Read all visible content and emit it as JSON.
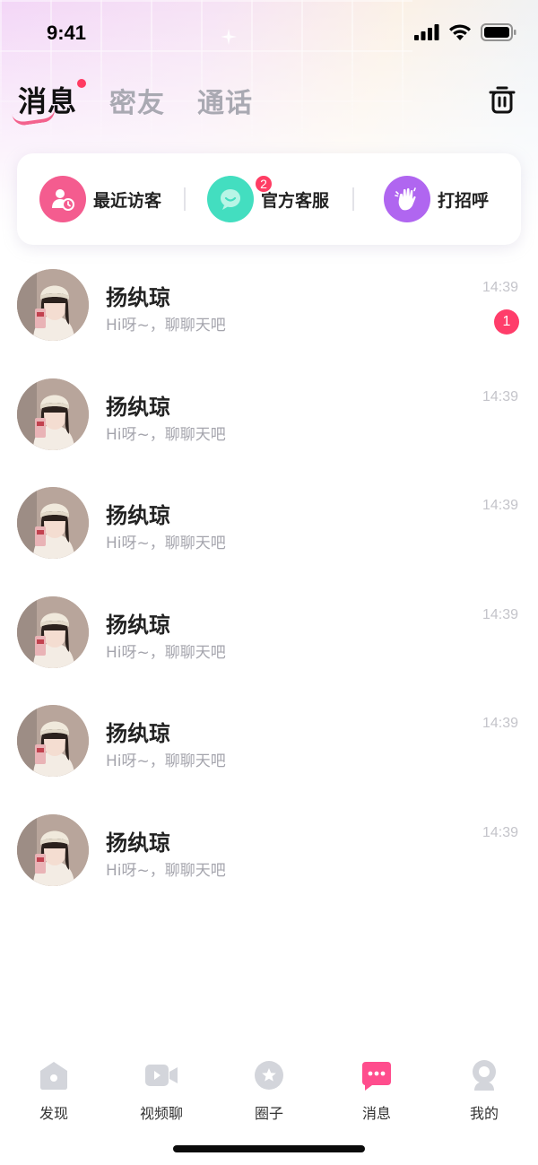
{
  "status_bar": {
    "time": "9:41"
  },
  "tabs": [
    {
      "label": "消息",
      "active": true,
      "dot": true
    },
    {
      "label": "密友",
      "active": false
    },
    {
      "label": "通话",
      "active": false
    }
  ],
  "header": {
    "trash_icon": "trash-icon"
  },
  "quick_actions": [
    {
      "label": "最近访客",
      "icon": "visitor-icon",
      "color": "#f45c8f"
    },
    {
      "label": "官方客服",
      "icon": "service-chat-icon",
      "color": "#43dec0",
      "badge": "2"
    },
    {
      "label": "打招呼",
      "icon": "wave-hand-icon",
      "color": "#b066f0"
    }
  ],
  "messages": [
    {
      "name": "扬纨琼",
      "preview": "Hi呀~，聊聊天吧",
      "time": "14:39",
      "unread": "1"
    },
    {
      "name": "扬纨琼",
      "preview": "Hi呀~，聊聊天吧",
      "time": "14:39"
    },
    {
      "name": "扬纨琼",
      "preview": "Hi呀~，聊聊天吧",
      "time": "14:39"
    },
    {
      "name": "扬纨琼",
      "preview": "Hi呀~，聊聊天吧",
      "time": "14:39"
    },
    {
      "name": "扬纨琼",
      "preview": "Hi呀~，聊聊天吧",
      "time": "14:39"
    },
    {
      "name": "扬纨琼",
      "preview": "Hi呀~，聊聊天吧",
      "time": "14:39"
    }
  ],
  "bottom_nav": [
    {
      "label": "发现",
      "icon": "home-icon",
      "active": false
    },
    {
      "label": "视频聊",
      "icon": "video-icon",
      "active": false
    },
    {
      "label": "圈子",
      "icon": "star-circle-icon",
      "active": false
    },
    {
      "label": "消息",
      "icon": "message-icon",
      "active": true
    },
    {
      "label": "我的",
      "icon": "profile-icon",
      "active": false
    }
  ],
  "colors": {
    "accent": "#ff4d8d",
    "badge": "#ff3d64",
    "inactive_tab": "#a9a9b2"
  }
}
